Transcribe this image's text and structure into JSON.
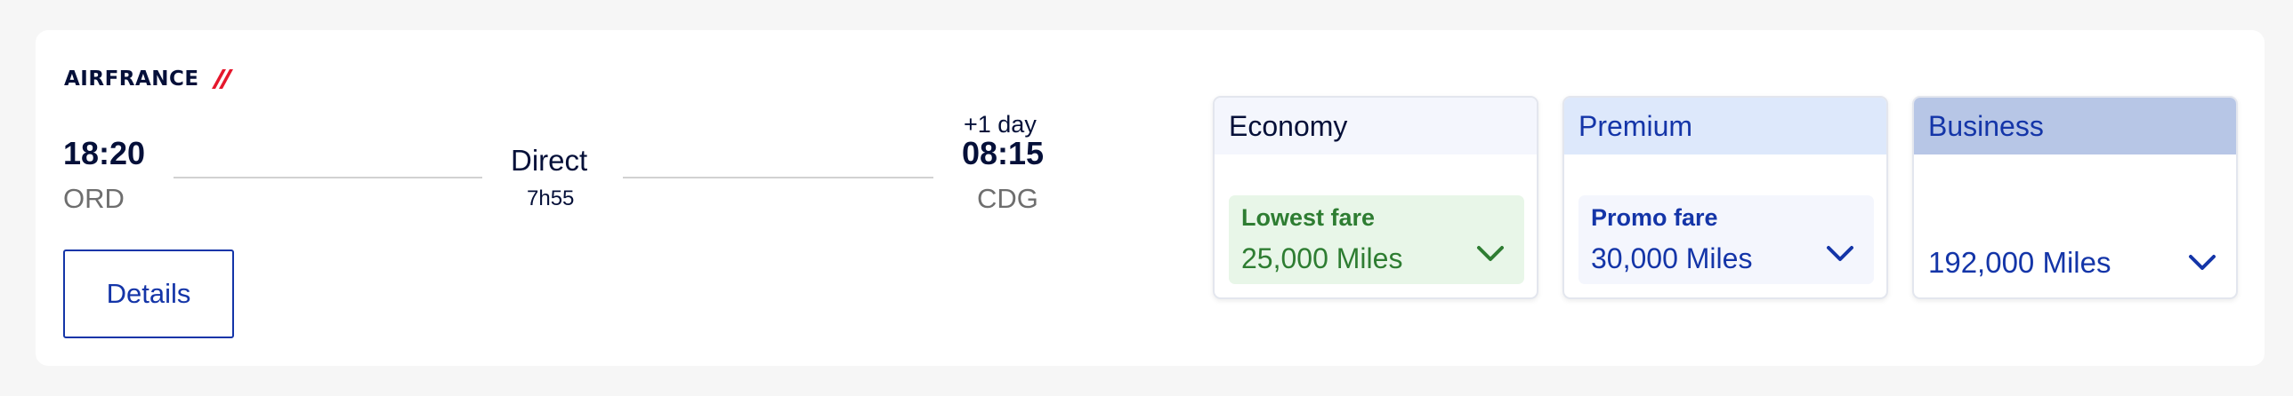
{
  "brand": {
    "logo_text": "AIRFRANCE"
  },
  "flight": {
    "departure_time": "18:20",
    "departure_airport": "ORD",
    "stop_type": "Direct",
    "duration": "7h55",
    "day_offset": "+1 day",
    "arrival_time": "08:15",
    "arrival_airport": "CDG"
  },
  "actions": {
    "details_label": "Details"
  },
  "fares": [
    {
      "cabin": "Economy",
      "fare_label": "Lowest fare",
      "miles": "25,000 Miles",
      "header_color": "#f4f6fd",
      "box_color": "#e8f6e8",
      "text_color": "#2e7d32"
    },
    {
      "cabin": "Premium",
      "fare_label": "Promo fare",
      "miles": "30,000 Miles",
      "header_color": "#dde8fb",
      "box_color": "#f4f6fd",
      "text_color": "#1435a8"
    },
    {
      "cabin": "Business",
      "fare_label": "",
      "miles": "192,000 Miles",
      "header_color": "#b7c6e6",
      "text_color": "#1435a8"
    }
  ],
  "icons": {
    "logo_mark": "airfrance-logo-mark",
    "dropdown": "chevron-down-icon"
  }
}
